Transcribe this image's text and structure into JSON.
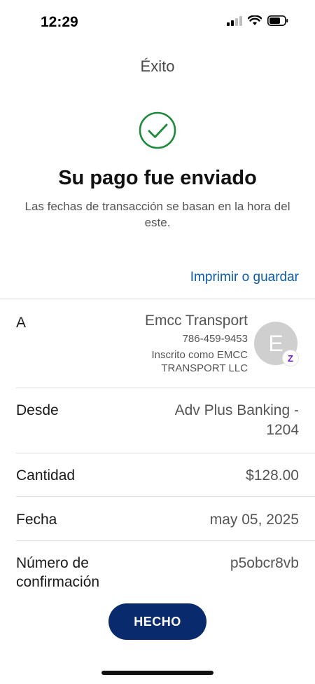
{
  "status_bar": {
    "time": "12:29"
  },
  "header": {
    "title": "Éxito"
  },
  "success": {
    "headline": "Su pago fue enviado",
    "subtext": "Las fechas de transacción se basan en la hora del este."
  },
  "actions": {
    "print_label": "Imprimir o guardar",
    "done_label": "HECHO"
  },
  "details": {
    "to": {
      "label": "A",
      "name": "Emcc Transport",
      "phone": "786-459-9453",
      "enrolled_line1": "Inscrito como EMCC",
      "enrolled_line2": "TRANSPORT LLC",
      "avatar_initial": "E",
      "badge_icon": "zelle-icon"
    },
    "from": {
      "label": "Desde",
      "value_line1": "Adv Plus Banking -",
      "value_line2": "1204"
    },
    "amount": {
      "label": "Cantidad",
      "value": "$128.00"
    },
    "date": {
      "label": "Fecha",
      "value": "may 05, 2025"
    },
    "confirmation": {
      "label_line1": "Número de",
      "label_line2": "confirmación",
      "value": "p5obcr8vb"
    }
  },
  "colors": {
    "success_green": "#1e8a3c",
    "link_blue": "#0b5ca8",
    "button_navy": "#0a2a6e",
    "zelle_purple": "#6d1ed4"
  }
}
